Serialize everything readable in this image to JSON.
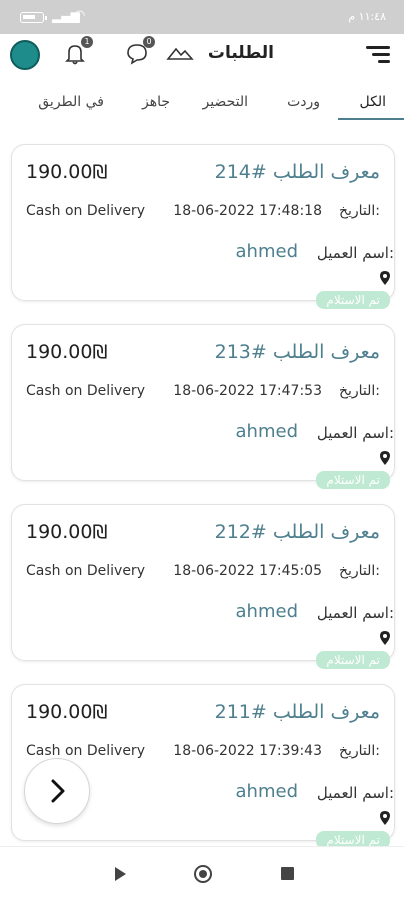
{
  "status_bar": {
    "time": "١١:٤٨ م",
    "battery_icon": "battery-icon",
    "signal_icon": "signal-icon",
    "wifi_icon": "wifi-icon"
  },
  "app_bar": {
    "title": "الطلبات",
    "notifications_badge": "1",
    "chat_badge": "0"
  },
  "tabs": [
    {
      "label": "الكل",
      "active": true
    },
    {
      "label": "وردت",
      "active": false
    },
    {
      "label": "التحضير",
      "active": false
    },
    {
      "label": "جاهز",
      "active": false
    },
    {
      "label": "في الطريق",
      "active": false
    }
  ],
  "orders": [
    {
      "order_id": "معرف الطلب #214",
      "price": "190.00₪",
      "date_label": "التاريخ:",
      "date": "18-06-2022 17:48:18",
      "payment": "Cash on Delivery",
      "customer_label": "اسم العميل:",
      "customer": "ahmed",
      "status": "تم الاستلام"
    },
    {
      "order_id": "معرف الطلب #213",
      "price": "190.00₪",
      "date_label": "التاريخ:",
      "date": "18-06-2022 17:47:53",
      "payment": "Cash on Delivery",
      "customer_label": "اسم العميل:",
      "customer": "ahmed",
      "status": "تم الاستلام"
    },
    {
      "order_id": "معرف الطلب #212",
      "price": "190.00₪",
      "date_label": "التاريخ:",
      "date": "18-06-2022 17:45:05",
      "payment": "Cash on Delivery",
      "customer_label": "اسم العميل:",
      "customer": "ahmed",
      "status": "تم الاستلام"
    },
    {
      "order_id": "معرف الطلب #211",
      "price": "190.00₪",
      "date_label": "التاريخ:",
      "date": "18-06-2022 17:39:43",
      "payment": "Cash on Delivery",
      "customer_label": "اسم العميل:",
      "customer": "ahmed",
      "status": "تم الاستلام"
    }
  ],
  "colors": {
    "accent": "#4e7f8f",
    "status_bg": "#bfe9d3",
    "status_bar_bg": "#cfcfcf"
  }
}
